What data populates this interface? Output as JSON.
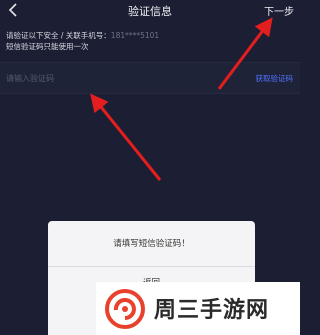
{
  "header": {
    "title": "验证信息",
    "next_label": "下一步"
  },
  "description": {
    "line1_text": "请验证以下安全 / 关联手机号：",
    "line1_phone": "181****5101",
    "line2": "短信验证码只能使用一次"
  },
  "verification": {
    "placeholder": "请输入验证码",
    "get_code_label": "获取验证码"
  },
  "dialog": {
    "message": "请填写短信验证码！",
    "button_label": "返回"
  },
  "watermark": {
    "text": "周三手游网"
  },
  "colors": {
    "background": "#1c1f33",
    "accent": "#4f74ff",
    "annotation_arrow": "#e41e1e",
    "watermark_logo": "#e8412c"
  }
}
